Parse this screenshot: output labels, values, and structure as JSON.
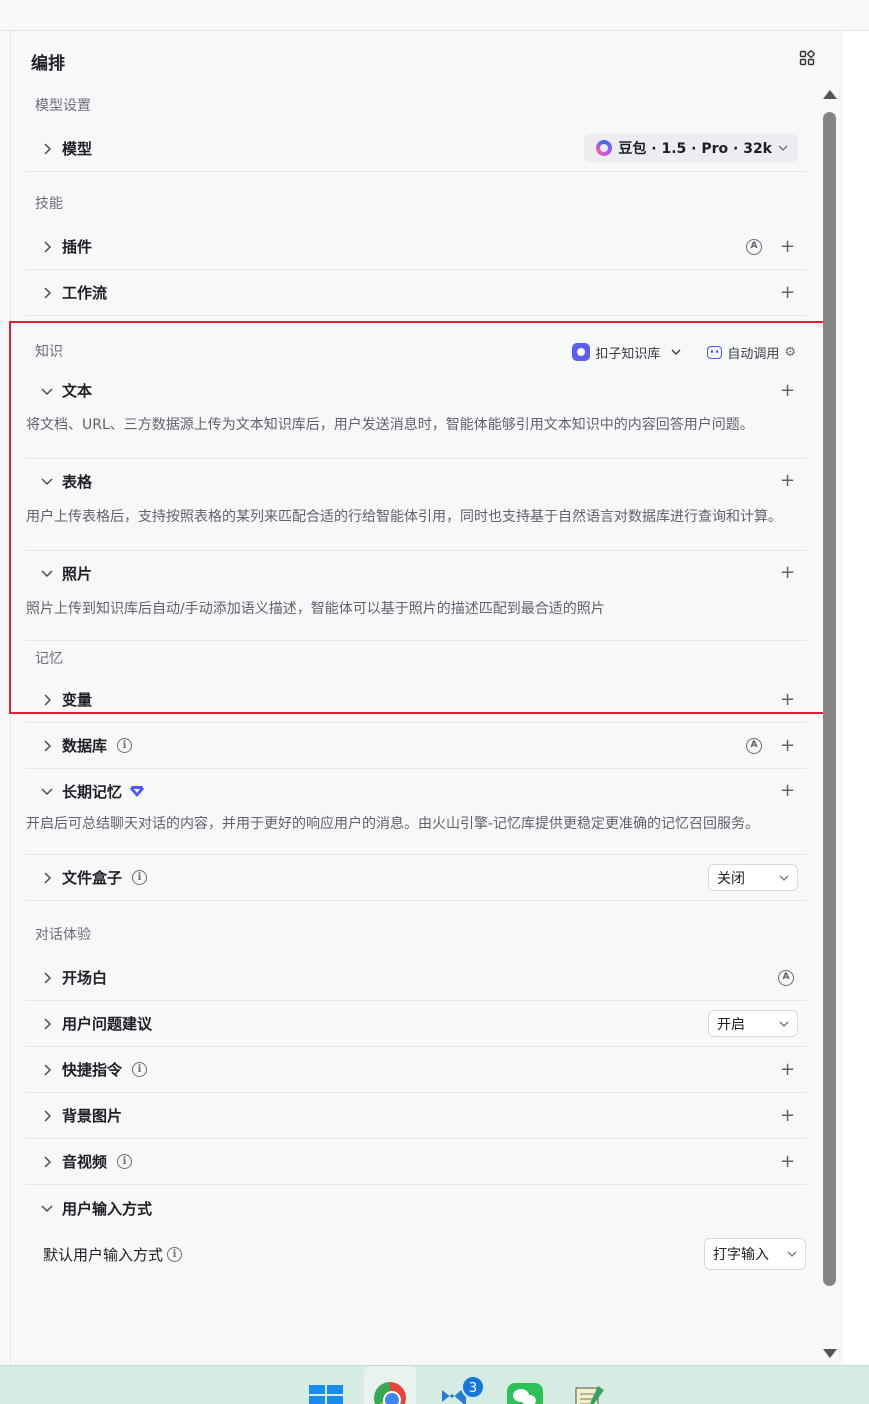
{
  "panel": {
    "title": "编排"
  },
  "model_section": {
    "title": "模型设置",
    "row_label": "模型",
    "model_value": "豆包 · 1.5 · Pro · 32k"
  },
  "skills_section": {
    "title": "技能",
    "plugin_label": "插件",
    "workflow_label": "工作流"
  },
  "knowledge_section": {
    "title": "知识",
    "kb_label": "扣子知识库",
    "auto_label": "自动调用",
    "text_label": "文本",
    "text_desc": "将文档、URL、三方数据源上传为文本知识库后，用户发送消息时，智能体能够引用文本知识中的内容回答用户问题。",
    "table_label": "表格",
    "table_desc": "用户上传表格后，支持按照表格的某列来匹配合适的行给智能体引用，同时也支持基于自然语言对数据库进行查询和计算。",
    "photo_label": "照片",
    "photo_desc": "照片上传到知识库后自动/手动添加语义描述，智能体可以基于照片的描述匹配到最合适的照片"
  },
  "memory_section": {
    "title": "记忆",
    "variable_label": "变量",
    "database_label": "数据库",
    "longterm_label": "长期记忆",
    "longterm_desc": "开启后可总结聊天对话的内容，并用于更好的响应用户的消息。由火山引擎-记忆库提供更稳定更准确的记忆召回服务。",
    "filebox_label": "文件盒子",
    "filebox_value": "关闭"
  },
  "dialog_section": {
    "title": "对话体验",
    "opening_label": "开场白",
    "suggest_label": "用户问题建议",
    "suggest_value": "开启",
    "shortcut_label": "快捷指令",
    "background_label": "背景图片",
    "av_label": "音视频",
    "input_label": "用户输入方式",
    "default_input_label": "默认用户输入方式",
    "default_input_value": "打字输入"
  },
  "taskbar": {
    "vs_badge": "3"
  },
  "colors": {
    "highlight": "#e0202f",
    "accent": "#4e57f5"
  }
}
